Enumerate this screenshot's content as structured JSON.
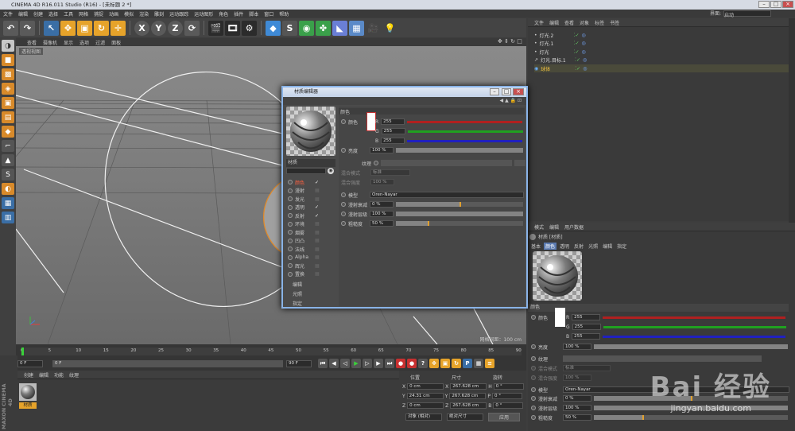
{
  "app": {
    "title": "CINEMA 4D R16.011 Studio (R16) - [未标题 2 *]",
    "layout_label": "界面:",
    "layout_value": "启动"
  },
  "menu": [
    "文件",
    "编辑",
    "创建",
    "选择",
    "工具",
    "网格",
    "捕捉",
    "动画",
    "模拟",
    "渲染",
    "雕刻",
    "运动跟踪",
    "运动图形",
    "角色",
    "插件",
    "脚本",
    "窗口",
    "帮助"
  ],
  "toolbar": {
    "x": "X",
    "y": "Y",
    "z": "Z"
  },
  "viewport": {
    "menu": [
      "查看",
      "摄像机",
      "显示",
      "选项",
      "过滤",
      "面板"
    ],
    "label": "透视视图",
    "grid_spacing": "网格间距：100 cm"
  },
  "objects": {
    "menu": [
      "文件",
      "编辑",
      "查看",
      "对象",
      "标签",
      "书签"
    ],
    "rows": [
      "灯光.2",
      "灯光.1",
      "灯光",
      "灯光.目标.1",
      "球体"
    ]
  },
  "attributes": {
    "menu": [
      "模式",
      "编辑",
      "用户数据"
    ],
    "title": "材质 [材质]",
    "tabs": [
      "基本",
      "颜色",
      "透明",
      "反射",
      "光照",
      "编辑",
      "指定"
    ],
    "section": "颜色",
    "color": "颜色",
    "r": "255",
    "g": "255",
    "b": "255",
    "brightness_label": "亮度",
    "brightness": "100 %",
    "texture": "纹理",
    "mix_mode": "混合模式",
    "mix_mode_value": "标准",
    "mix_strength": "混合强度",
    "mix_strength_value": "100 %",
    "model": "模型",
    "model_value": "Oren-Nayar",
    "diffuse_falloff": "漫射衰减",
    "diffuse_falloff_value": "0 %",
    "diffuse_level": "漫射层级",
    "diffuse_level_value": "100 %",
    "roughness": "粗糙度",
    "roughness_value": "50 %"
  },
  "dialog": {
    "title": "材质编辑器",
    "mat_name": "材质",
    "channels": [
      {
        "label": "颜色",
        "checked": true,
        "active": true
      },
      {
        "label": "漫射",
        "checked": false
      },
      {
        "label": "发光",
        "checked": false
      },
      {
        "label": "透明",
        "checked": true
      },
      {
        "label": "反射",
        "checked": true
      },
      {
        "label": "环境",
        "checked": false
      },
      {
        "label": "烟雾",
        "checked": false
      },
      {
        "label": "凹凸",
        "checked": false
      },
      {
        "label": "法线",
        "checked": false
      },
      {
        "label": "Alpha",
        "checked": false
      },
      {
        "label": "辉光",
        "checked": false
      },
      {
        "label": "置换",
        "checked": false
      }
    ],
    "extra": [
      "编辑",
      "光照",
      "指定"
    ]
  },
  "timeline": {
    "ticks": [
      "0",
      "5",
      "10",
      "15",
      "20",
      "25",
      "30",
      "35",
      "40",
      "45",
      "50",
      "55",
      "60",
      "65",
      "70",
      "75",
      "80",
      "85",
      "90"
    ],
    "frame_end": "0 F",
    "start": "0 F",
    "current": "0 F",
    "end": "90 F",
    "end2": "90 F"
  },
  "material_manager": {
    "menu": [
      "创建",
      "编辑",
      "功能",
      "纹理"
    ],
    "material": "材质",
    "brand1": "MAXON",
    "brand2": "CINEMA 4D"
  },
  "coords": {
    "headers": [
      "位置",
      "尺寸",
      "旋转"
    ],
    "rows": [
      {
        "axis": "X",
        "pos": "0 cm",
        "size": "267.628 cm",
        "rot_axis": "H",
        "rot": "0 °"
      },
      {
        "axis": "Y",
        "pos": "24.31 cm",
        "size": "267.628 cm",
        "rot_axis": "P",
        "rot": "0 °"
      },
      {
        "axis": "Z",
        "pos": "0 cm",
        "size": "267.628 cm",
        "rot_axis": "B",
        "rot": "0 °"
      }
    ],
    "mode": "对象 (相对)",
    "size_mode": "绝对尺寸",
    "apply": "应用"
  },
  "watermark": {
    "logo": "Bai 经验",
    "url": "jingyan.baidu.com"
  }
}
